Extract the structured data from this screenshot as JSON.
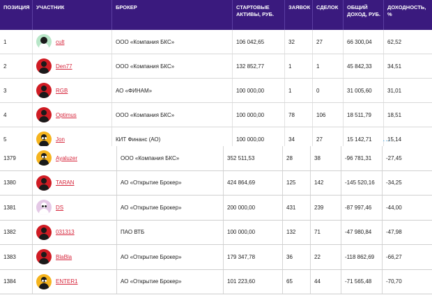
{
  "header": {
    "position": "ПОЗИЦИЯ",
    "participant": "УЧАСТНИК",
    "broker": "БРОКЕР",
    "assets": "СТАРТОВЫЕ АКТИВЫ, РУБ.",
    "orders": "ЗАЯВОК",
    "deals": "СДЕЛОК",
    "income": "ОБЩИЙ ДОХОД, РУБ.",
    "yield": "ДОХОДНОСТЬ, %"
  },
  "top_rows": [
    {
      "pos": "1",
      "name": "cult",
      "broker": "ООО «Компания БКС»",
      "assets": "106 042,65",
      "orders": "32",
      "deals": "27",
      "income": "66 300,04",
      "yield": "62,52",
      "avatar_color": "#b8e6c8",
      "avatar_style": "green"
    },
    {
      "pos": "2",
      "name": "Den77",
      "broker": "ООО «Компания БКС»",
      "assets": "132 852,77",
      "orders": "1",
      "deals": "1",
      "income": "45 842,33",
      "yield": "34,51",
      "avatar_color": "#d01c24",
      "avatar_style": "red"
    },
    {
      "pos": "3",
      "name": "RGB",
      "broker": "АО «ФИНАМ»",
      "assets": "100 000,00",
      "orders": "1",
      "deals": "0",
      "income": "31 005,60",
      "yield": "31,01",
      "avatar_color": "#d01c24",
      "avatar_style": "red"
    },
    {
      "pos": "4",
      "name": "Optimus",
      "broker": "ООО «Компания БКС»",
      "assets": "100 000,00",
      "orders": "78",
      "deals": "106",
      "income": "18 511,79",
      "yield": "18,51",
      "avatar_color": "#d01c24",
      "avatar_style": "red"
    },
    {
      "pos": "5",
      "name": "Jon",
      "broker": "КИТ Финанс (АО)",
      "assets": "100 000,00",
      "orders": "34",
      "deals": "27",
      "income": "15 142,71",
      "yield": "15,14",
      "avatar_color": "#f5b41e",
      "avatar_style": "yellow"
    }
  ],
  "bottom_rows": [
    {
      "pos": "1379",
      "name": "Ayaluzer",
      "broker": "ООО «Компания БКС»",
      "assets": "352 511,53",
      "orders": "28",
      "deals": "38",
      "income": "-96 781,31",
      "yield": "-27,45",
      "avatar_color": "#f5b41e",
      "avatar_style": "yellow"
    },
    {
      "pos": "1380",
      "name": "TARAN",
      "broker": "АО «Открытие Брокер»",
      "assets": "424 864,69",
      "orders": "125",
      "deals": "142",
      "income": "-145 520,16",
      "yield": "-34,25",
      "avatar_color": "#d01c24",
      "avatar_style": "red"
    },
    {
      "pos": "1381",
      "name": "DS",
      "broker": "АО «Открытие Брокер»",
      "assets": "200 000,00",
      "orders": "431",
      "deals": "239",
      "income": "-87 997,46",
      "yield": "-44,00",
      "avatar_color": "#e4c8e6",
      "avatar_style": "pink"
    },
    {
      "pos": "1382",
      "name": "031313",
      "broker": "ПАО ВТБ",
      "assets": "100 000,00",
      "orders": "132",
      "deals": "71",
      "income": "-47 980,84",
      "yield": "-47,98",
      "avatar_color": "#d01c24",
      "avatar_style": "red"
    },
    {
      "pos": "1383",
      "name": "BlaBla",
      "broker": "АО «Открытие Брокер»",
      "assets": "179 347,78",
      "orders": "36",
      "deals": "22",
      "income": "-118 862,69",
      "yield": "-66,27",
      "avatar_color": "#d01c24",
      "avatar_style": "red"
    },
    {
      "pos": "1384",
      "name": "ENTER1",
      "broker": "АО «Открытие Брокер»",
      "assets": "101 223,60",
      "orders": "65",
      "deals": "44",
      "income": "-71 565,48",
      "yield": "-70,70",
      "avatar_color": "#f5b41e",
      "avatar_style": "yellow"
    }
  ]
}
